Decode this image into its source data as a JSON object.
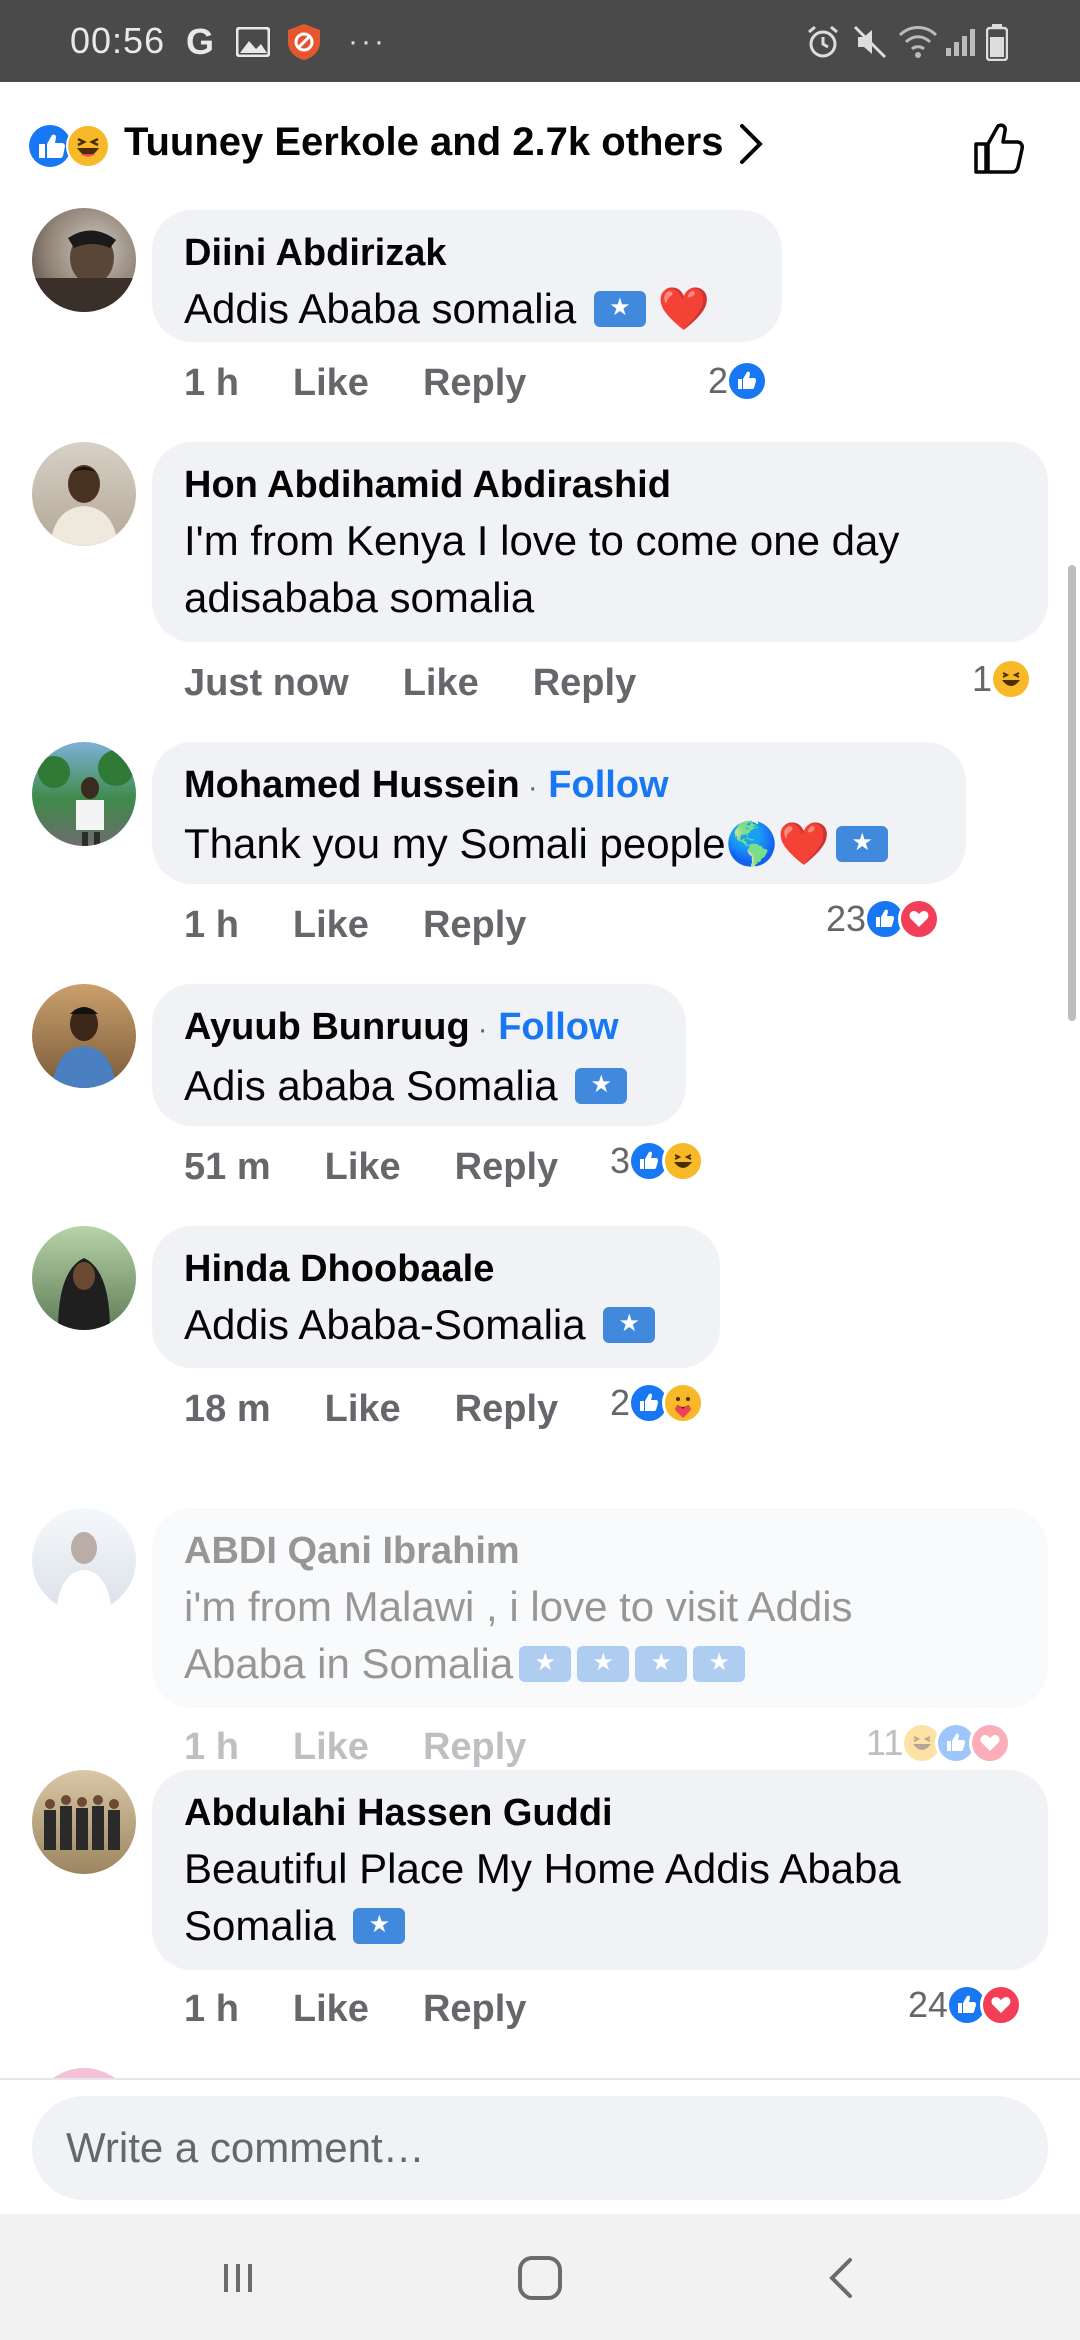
{
  "status_bar": {
    "time": "00:56",
    "google_letter": "G",
    "more": "···"
  },
  "reactions_header": {
    "summary": "Tuuney Eerkole and 2.7k others"
  },
  "comments": [
    {
      "name": "Diini Abdirizak",
      "follow": "",
      "text": "Addis Ababa somalia",
      "emoji": "❤️",
      "time": "1 h",
      "like": "Like",
      "reply": "Reply",
      "reaction_count": "2"
    },
    {
      "name": "Hon Abdihamid Abdirashid",
      "follow": "",
      "text_line1": "I'm from Kenya I love to come one day",
      "text_line2": "adisababa somalia",
      "time": "Just now",
      "like": "Like",
      "reply": "Reply",
      "reaction_count": "1"
    },
    {
      "name": "Mohamed Hussein",
      "follow_sep": "·",
      "follow": "Follow",
      "text": "Thank you my Somali people",
      "emoji": "🌎❤️",
      "time": "1 h",
      "like": "Like",
      "reply": "Reply",
      "reaction_count": "23"
    },
    {
      "name": "Ayuub Bunruug",
      "follow_sep": "·",
      "follow": "Follow",
      "text": "Adis ababa Somalia",
      "time": "51 m",
      "like": "Like",
      "reply": "Reply",
      "reaction_count": "3"
    },
    {
      "name": "Hinda Dhoobaale",
      "text": "Addis Ababa-Somalia",
      "time": "18 m",
      "like": "Like",
      "reply": "Reply",
      "reaction_count": "2"
    },
    {
      "name": "ABDI Qani Ibrahim",
      "text_line1": "i'm from Malawi , i love to visit Addis",
      "text_line2": "Ababa in Somalia",
      "time": "1 h",
      "like": "Like",
      "reply": "Reply",
      "reaction_count": "11"
    },
    {
      "name": "Abdulahi Hassen Guddi",
      "text_line1": "Beautiful Place My Home Addis Ababa",
      "text_line2": "Somalia",
      "time": "1 h",
      "like": "Like",
      "reply": "Reply",
      "reaction_count": "24"
    }
  ],
  "composer": {
    "placeholder": "Write a comment…"
  },
  "icons": {
    "like": "like-reaction-icon",
    "haha": "haha-reaction-icon",
    "love": "love-reaction-icon",
    "care": "care-reaction-icon",
    "flag": "somalia-flag-icon"
  },
  "colors": {
    "accent": "#1877f2",
    "love": "#f33e58",
    "haha": "#f7b928",
    "bubble": "#f0f2f5",
    "status_bar": "#4a4a4a"
  }
}
